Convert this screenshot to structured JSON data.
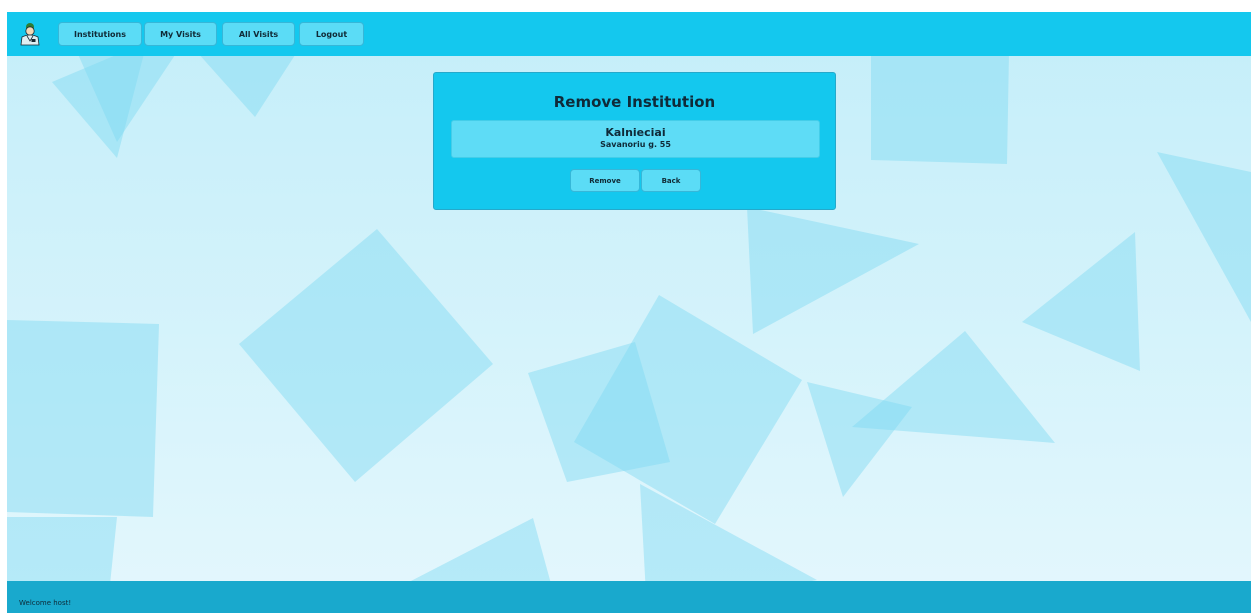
{
  "nav": {
    "items": [
      {
        "label": "Institutions"
      },
      {
        "label": "My Visits"
      },
      {
        "label": "All Visits"
      },
      {
        "label": "Logout"
      }
    ],
    "logo_icon": "doctor-user-icon"
  },
  "card": {
    "title": "Remove Institution",
    "institution": {
      "name": "Kalnieciai",
      "address": "Savanoriu g. 55"
    },
    "remove_label": "Remove",
    "back_label": "Back"
  },
  "footer": {
    "welcome": "Welcome host!"
  },
  "colors": {
    "topbar": "#14c8ee",
    "button": "#5bdcf6",
    "footer": "#19a9cd",
    "background": "#c4eef9"
  }
}
